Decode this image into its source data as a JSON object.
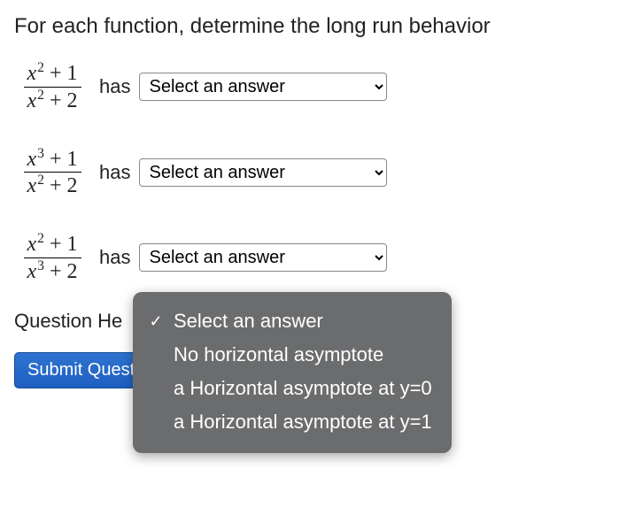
{
  "prompt": "For each function, determine the long run behavior",
  "questions": [
    {
      "numerator_html": "<i>x</i><sup>2</sup> <span class='plus'>+ 1</span>",
      "denominator_html": "<i>x</i><sup>2</sup> <span class='plus'>+ 2</span>",
      "has_label": "has",
      "select_placeholder": "Select an answer"
    },
    {
      "numerator_html": "<i>x</i><sup>3</sup> <span class='plus'>+ 1</span>",
      "denominator_html": "<i>x</i><sup>2</sup> <span class='plus'>+ 2</span>",
      "has_label": "has",
      "select_placeholder": "Select an answer"
    },
    {
      "numerator_html": "<i>x</i><sup>2</sup> <span class='plus'>+ 1</span>",
      "denominator_html": "<i>x</i><sup>3</sup> <span class='plus'>+ 2</span>",
      "has_label": "has",
      "select_placeholder": "Select an answer"
    }
  ],
  "help_label": "Question He",
  "submit_label": "Submit Question",
  "dropdown": {
    "options": [
      {
        "checked": true,
        "label": "Select an answer"
      },
      {
        "checked": false,
        "label": "No horizontal asymptote"
      },
      {
        "checked": false,
        "label": "a Horizontal asymptote at y=0"
      },
      {
        "checked": false,
        "label": "a Horizontal asymptote at y=1"
      }
    ]
  }
}
